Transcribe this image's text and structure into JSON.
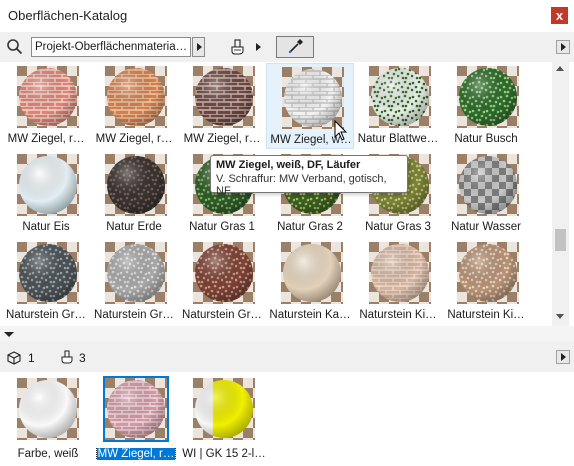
{
  "window": {
    "title": "Oberflächen-Katalog",
    "close_symbol": "x"
  },
  "toolbar": {
    "library_select": "Projekt-Oberflächenmateria…"
  },
  "tooltip": {
    "title": "MW Ziegel, weiß, DF, Läufer",
    "subtitle": "V. Schraffur: MW Verband, gotisch, NF"
  },
  "catalog": [
    {
      "label": "MW Ziegel, r…",
      "material": "brick-salmon"
    },
    {
      "label": "MW Ziegel, r…",
      "material": "brick-orange"
    },
    {
      "label": "MW Ziegel, r…",
      "material": "brick-dark"
    },
    {
      "label": "MW Ziegel, w…",
      "material": "brick-white"
    },
    {
      "label": "Natur Blattwe…",
      "material": "leaves-white"
    },
    {
      "label": "Natur Busch",
      "material": "bush"
    },
    {
      "label": "Natur Eis",
      "material": "ice"
    },
    {
      "label": "Natur Erde",
      "material": "earth"
    },
    {
      "label": "Natur Gras 1",
      "material": "grass-1"
    },
    {
      "label": "Natur Gras 2",
      "material": "grass-2"
    },
    {
      "label": "Natur Gras 3",
      "material": "grass-3"
    },
    {
      "label": "Natur Wasser",
      "material": "water"
    },
    {
      "label": "Naturstein Gr…",
      "material": "granite-dark"
    },
    {
      "label": "Naturstein Gr…",
      "material": "granite-light"
    },
    {
      "label": "Naturstein Gr…",
      "material": "granite-red"
    },
    {
      "label": "Naturstein Ka…",
      "material": "stone-beige"
    },
    {
      "label": "Naturstein Ki…",
      "material": "stone-pebble"
    },
    {
      "label": "Naturstein Ki…",
      "material": "stone-gravel"
    }
  ],
  "counts": {
    "surfaces": "1",
    "brushes": "3"
  },
  "project_surfaces": [
    {
      "label": "Farbe, weiß",
      "material": "white"
    },
    {
      "label": "MW Ziegel, r…",
      "material": "brick-pink"
    },
    {
      "label": "WI | GK 15 2-l…",
      "material": "yellow-wall"
    }
  ],
  "colors": {
    "selection": "#0078d7",
    "close": "#c0392b",
    "hover": "#e5f1fb"
  }
}
